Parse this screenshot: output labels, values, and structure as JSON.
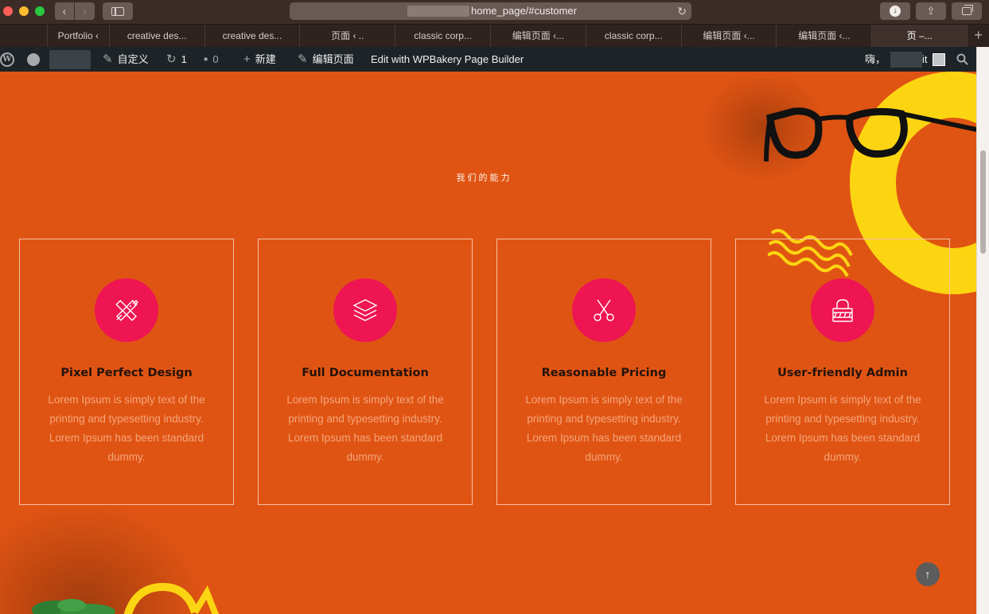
{
  "browser": {
    "url": "home_page/#customer",
    "tabs": [
      {
        "label": ""
      },
      {
        "label": "Portfolio ‹"
      },
      {
        "label": "creative des..."
      },
      {
        "label": "creative des..."
      },
      {
        "label": "页面 ‹   .."
      },
      {
        "label": "classic corp..."
      },
      {
        "label": "编辑页面 ‹..."
      },
      {
        "label": "classic corp..."
      },
      {
        "label": "编辑页面 ‹..."
      },
      {
        "label": "编辑页面 ‹..."
      },
      {
        "label": "页 –..."
      }
    ],
    "new_tab": "+"
  },
  "admin_bar": {
    "customize": "自定义",
    "updates_count": "1",
    "comments_count": "0",
    "new": "新建",
    "edit_page": "编辑页面",
    "wpbakery": "Edit with WPBakery Page Builder",
    "greeting": "嗨，",
    "greeting_suffix": "it"
  },
  "section": {
    "title": "我们的能力"
  },
  "cards": [
    {
      "title": "Pixel Perfect Design",
      "text": "Lorem Ipsum is simply text of the printing and typesetting industry. Lorem Ipsum has been standard dummy.",
      "icon": "pencil-ruler-icon"
    },
    {
      "title": "Full Documentation",
      "text": "Lorem Ipsum is simply text of the printing and typesetting industry. Lorem Ipsum has been standard dummy.",
      "icon": "layers-icon"
    },
    {
      "title": "Reasonable Pricing",
      "text": "Lorem Ipsum is simply text of the printing and typesetting industry. Lorem Ipsum has been standard dummy.",
      "icon": "scissors-icon"
    },
    {
      "title": "User-friendly Admin",
      "text": "Lorem Ipsum is simply text of the printing and typesetting industry. Lorem Ipsum has been standard dummy.",
      "icon": "lock-icon"
    }
  ],
  "colors": {
    "page_bg": "#e05413",
    "accent_circle": "#ee1552",
    "ring_yellow": "#fcd512"
  }
}
